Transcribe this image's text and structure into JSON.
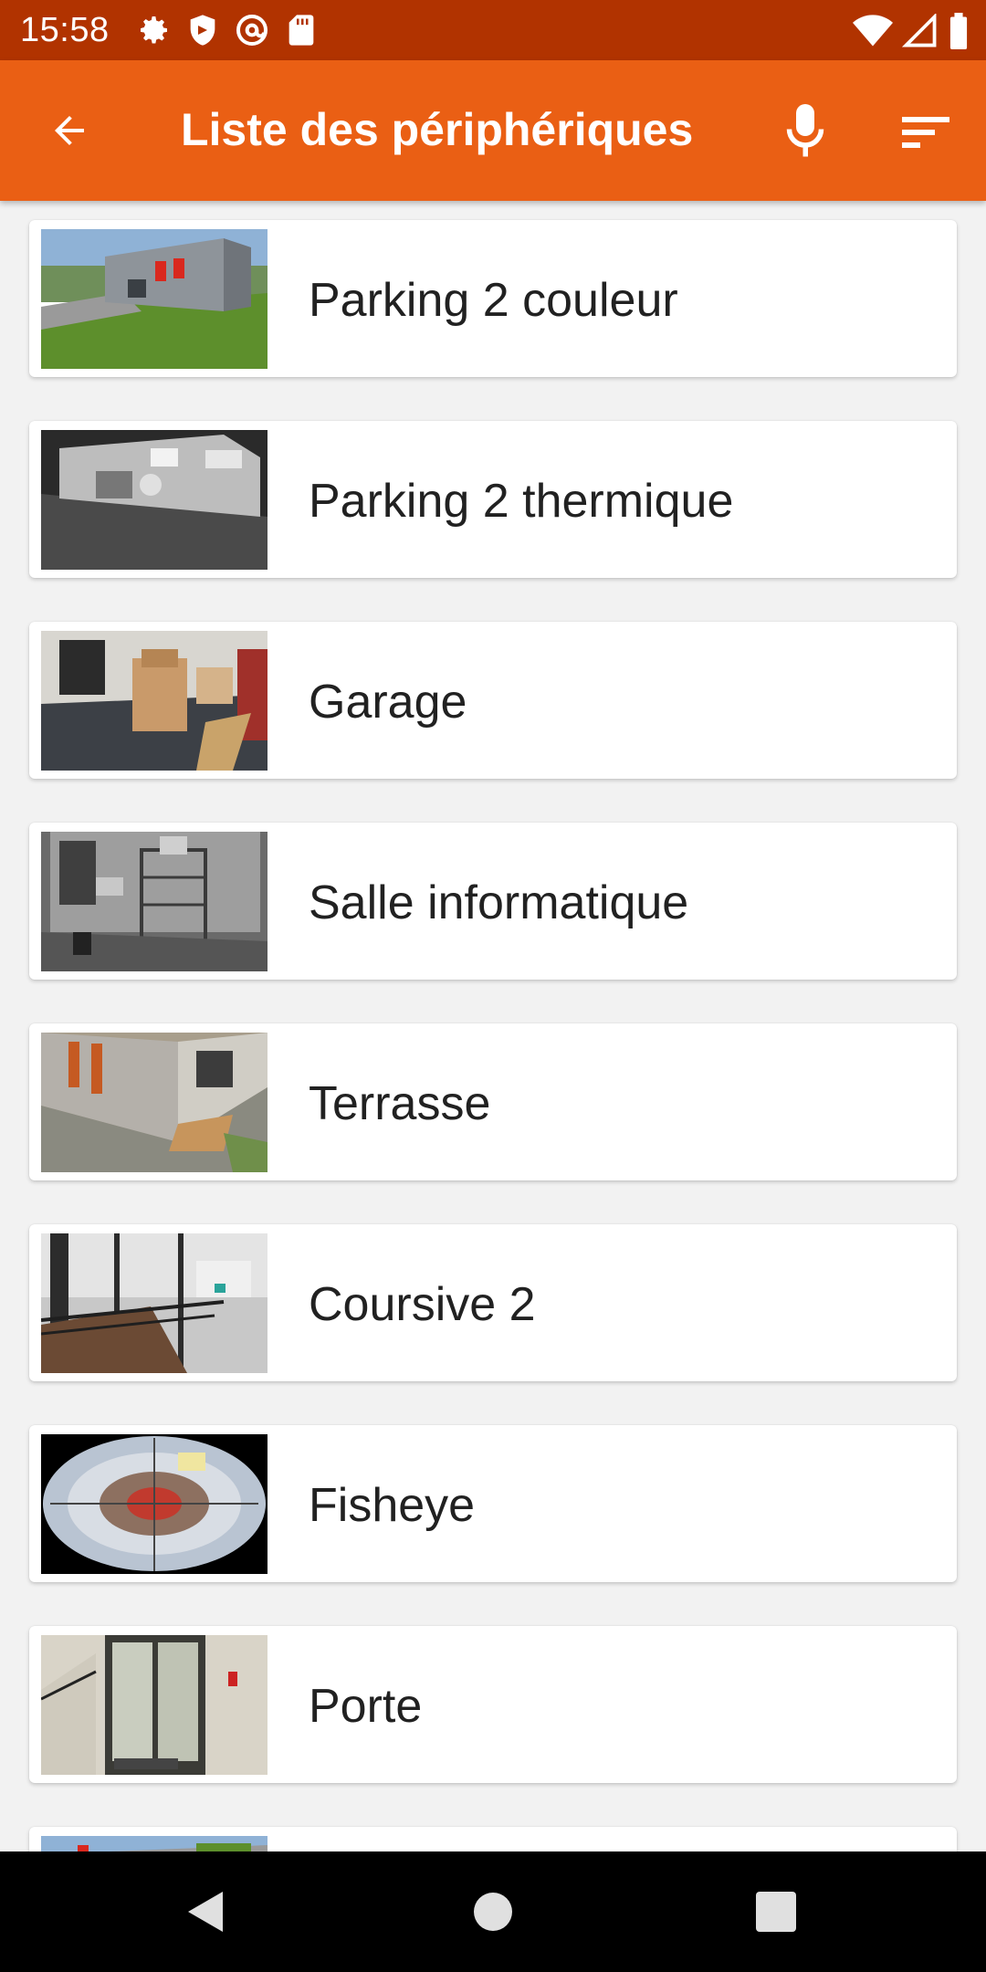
{
  "status_bar": {
    "time": "15:58",
    "left_icons": [
      "gear-icon",
      "shield-icon",
      "at-sign-icon",
      "sd-card-icon"
    ],
    "right_icons": [
      "wifi-icon",
      "signal-icon",
      "battery-icon"
    ]
  },
  "app_bar": {
    "title": "Liste des périphériques",
    "back_icon": "arrow-back-icon",
    "actions": [
      "microphone-icon",
      "sort-icon"
    ],
    "background": "#ea5f14",
    "status_background": "#b13300"
  },
  "devices": [
    {
      "label": "Parking 2 couleur",
      "thumbnail": "building-exterior-color"
    },
    {
      "label": "Parking 2 thermique",
      "thumbnail": "building-exterior-thermal"
    },
    {
      "label": "Garage",
      "thumbnail": "garage-interior"
    },
    {
      "label": "Salle informatique",
      "thumbnail": "server-room-grayscale"
    },
    {
      "label": "Terrasse",
      "thumbnail": "terrace"
    },
    {
      "label": "Coursive 2",
      "thumbnail": "walkway-interior"
    },
    {
      "label": "Fisheye",
      "thumbnail": "fisheye-view"
    },
    {
      "label": "Porte",
      "thumbnail": "glass-door"
    },
    {
      "label": "",
      "thumbnail": "building-exterior-partial"
    }
  ],
  "nav_bar": {
    "buttons": [
      "back-triangle-icon",
      "home-circle-icon",
      "recents-square-icon"
    ]
  }
}
